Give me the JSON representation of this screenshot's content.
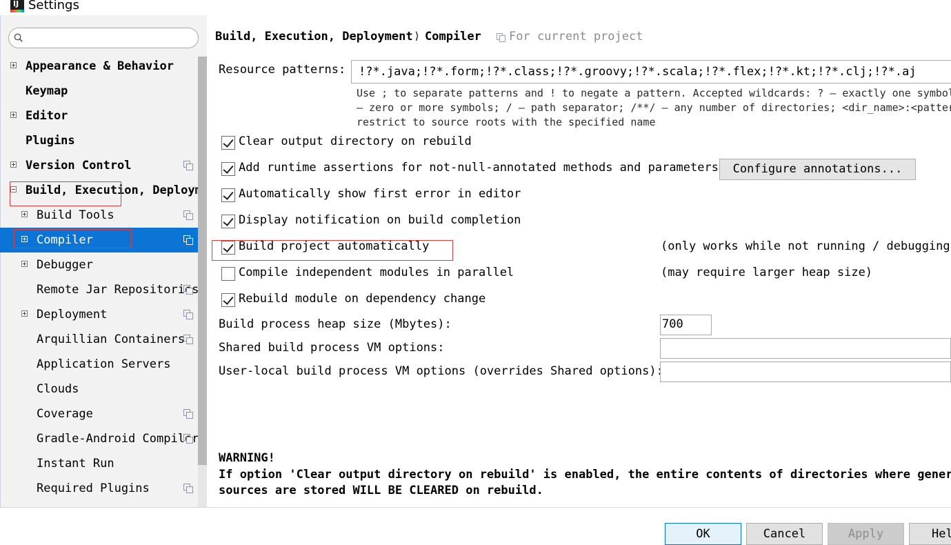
{
  "window": {
    "title": "Settings"
  },
  "sidebar": {
    "search": {
      "placeholder": "",
      "value": ""
    },
    "items": [
      {
        "label": "Appearance & Behavior",
        "bold": true,
        "expander": "plus"
      },
      {
        "label": "Keymap",
        "bold": true
      },
      {
        "label": "Editor",
        "bold": true,
        "expander": "plus"
      },
      {
        "label": "Plugins",
        "bold": true
      },
      {
        "label": "Version Control",
        "bold": true,
        "expander": "plus",
        "project_icon": true
      },
      {
        "label": "Build, Execution, Deployment",
        "bold": true,
        "expander": "minus"
      },
      {
        "label": "Build Tools",
        "expander": "plus",
        "project_icon": true
      },
      {
        "label": "Compiler",
        "expander": "plus",
        "project_icon": true,
        "selected": true
      },
      {
        "label": "Debugger",
        "expander": "plus"
      },
      {
        "label": "Remote Jar Repositories",
        "project_icon": true
      },
      {
        "label": "Deployment",
        "expander": "plus",
        "project_icon": true
      },
      {
        "label": "Arquillian Containers",
        "project_icon": true
      },
      {
        "label": "Application Servers"
      },
      {
        "label": "Clouds"
      },
      {
        "label": "Coverage",
        "project_icon": true
      },
      {
        "label": "Gradle-Android Compiler",
        "project_icon": true
      },
      {
        "label": "Instant Run"
      },
      {
        "label": "Required Plugins",
        "project_icon": true
      }
    ]
  },
  "breadcrumb": {
    "section": "Build, Execution, Deployment",
    "separator": "⟩",
    "current": "Compiler",
    "scope_label": "For current project"
  },
  "compiler": {
    "resource_patterns_label": "Resource patterns:",
    "resource_patterns_value": "!?*.java;!?*.form;!?*.class;!?*.groovy;!?*.scala;!?*.flex;!?*.kt;!?*.clj;!?*.aj",
    "hint_lines": [
      "Use ; to separate patterns and ! to negate a pattern. Accepted wildcards: ? — exactly one symbol;",
      "— zero or more symbols; / — path separator; /**/ — any number of directories; <dir_name>:<pattern>",
      "restrict to source roots with the specified name"
    ],
    "options": [
      {
        "label": "Clear output directory on rebuild",
        "checked": true
      },
      {
        "label": "Add runtime assertions for not-null-annotated methods and parameters",
        "checked": true
      },
      {
        "label": "Automatically show first error in editor",
        "checked": true
      },
      {
        "label": "Display notification on build completion",
        "checked": true
      },
      {
        "label": "Build project automatically",
        "checked": true,
        "note": "(only works while not running / debugging)"
      },
      {
        "label": "Compile independent modules in parallel",
        "checked": false,
        "note": "(may require larger heap size)"
      },
      {
        "label": "Rebuild module on dependency change",
        "checked": true
      }
    ],
    "configure_annotations_label": "Configure annotations...",
    "heap_size_label": "Build process heap size (Mbytes):",
    "heap_size_value": "700",
    "shared_vm_label": "Shared build process VM options:",
    "shared_vm_value": "",
    "user_vm_label": "User-local build process VM options (overrides Shared options):",
    "user_vm_value": "",
    "warning_title": "WARNING!",
    "warning_lines": [
      "If option 'Clear output directory on rebuild' is enabled, the entire contents of directories where generated",
      "sources are stored WILL BE CLEARED on rebuild."
    ]
  },
  "buttons": {
    "ok": "OK",
    "cancel": "Cancel",
    "apply": "Apply",
    "help": "Help"
  },
  "colors": {
    "selection": "#0b74d4",
    "highlight_box": "#e23b3b",
    "sidebar_bg": "#f2f2f2"
  }
}
